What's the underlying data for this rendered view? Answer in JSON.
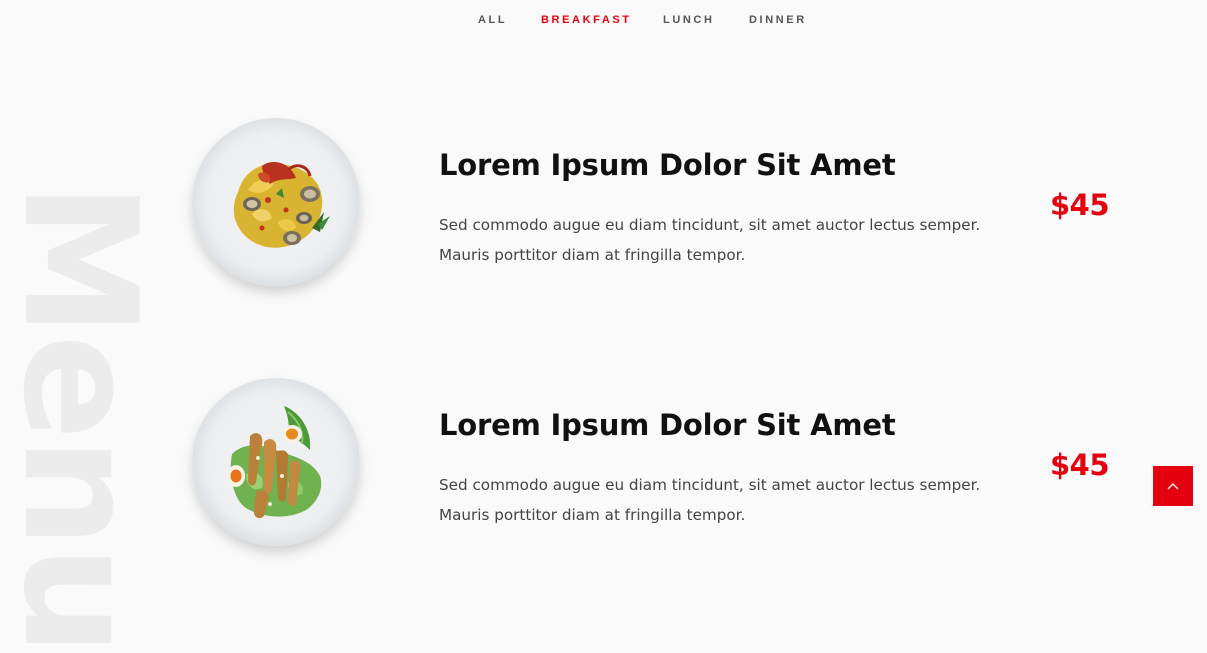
{
  "tabs": [
    {
      "label": "ALL",
      "active": false
    },
    {
      "label": "BREAKFAST",
      "active": true
    },
    {
      "label": "LUNCH",
      "active": false
    },
    {
      "label": "DINNER",
      "active": false
    }
  ],
  "side_title": "Menu",
  "items": [
    {
      "image": "pasta-clams-dish",
      "title": "Lorem Ipsum Dolor Sit Amet",
      "desc_line1": "Sed commodo augue eu diam tincidunt, sit amet auctor lectus semper.",
      "desc_line2": "Mauris porttitor diam at fringilla tempor.",
      "price": "$45"
    },
    {
      "image": "caesar-salad-dish",
      "title": "Lorem Ipsum Dolor Sit Amet",
      "desc_line1": "Sed commodo augue eu diam tincidunt, sit amet auctor lectus semper.",
      "desc_line2": "Mauris porttitor diam at fringilla tempor.",
      "price": "$45"
    }
  ],
  "scroll_top": {
    "icon": "chevron-up-icon"
  },
  "colors": {
    "accent": "#e50010",
    "background": "#fafafa",
    "title": "#111111",
    "text": "#444444",
    "tab_inactive": "#555555",
    "watermark": "#ececec"
  }
}
